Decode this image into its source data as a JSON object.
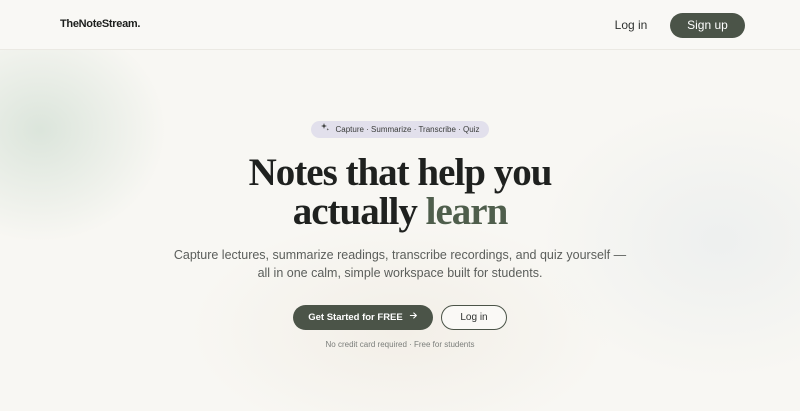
{
  "header": {
    "logo": "TheNoteStream.",
    "login_label": "Log in",
    "signup_label": "Sign up"
  },
  "hero": {
    "pill_text": "Capture · Summarize · Transcribe · Quiz",
    "pill_icon": "sparkle-icon",
    "title_line1": "Notes that help you",
    "title_line2_plain": "actually",
    "title_line2_accent": "learn",
    "subtitle_line1": "Capture lectures, summarize readings, transcribe recordings, and quiz yourself —",
    "subtitle_line2": "all in one calm, simple workspace built for students.",
    "cta_primary_label": "Get Started for FREE",
    "cta_primary_icon": "arrow-right-icon",
    "cta_secondary_label": "Log in",
    "note": "No credit card required · Free for students"
  },
  "colors": {
    "brand_dark": "#4b5448",
    "accent_text": "#4f5e4c",
    "pill_bg": "#e2e0ec",
    "page_bg": "#f8f7f3"
  }
}
